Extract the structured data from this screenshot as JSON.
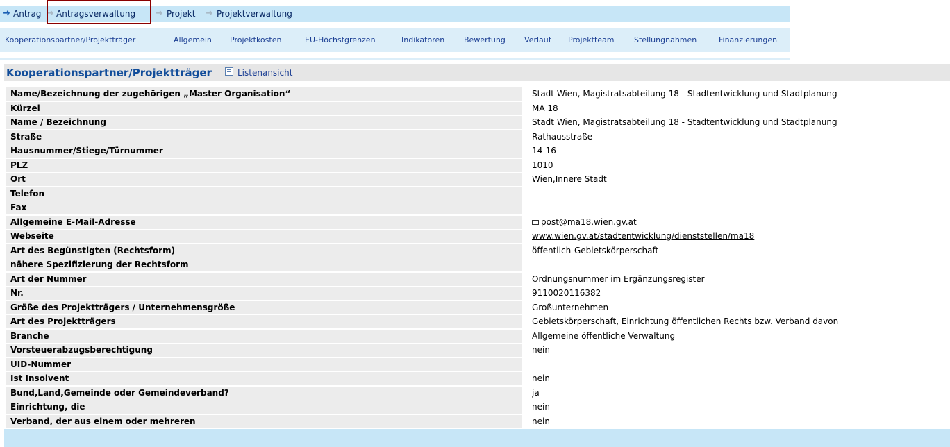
{
  "breadcrumb": {
    "items": [
      "Antrag",
      "Antragsverwaltung",
      "Projekt",
      "Projektverwaltung"
    ]
  },
  "tabs": [
    "Kooperationspartner/Projektträger",
    "Allgemein",
    "Projektkosten",
    "EU-Höchstgrenzen",
    "Indikatoren",
    "Bewertung",
    "Verlauf",
    "Projektteam",
    "Stellungnahmen",
    "Finanzierungen"
  ],
  "section": {
    "title": "Kooperationspartner/Projektträger",
    "list_view_label": "Listenansicht",
    "list_icon": "list-view-icon"
  },
  "rows": [
    {
      "label": "Name/Bezeichnung der zugehörigen „Master Organisation“",
      "value": "Stadt Wien, Magistratsabteilung 18 - Stadtentwicklung und Stadtplanung"
    },
    {
      "label": "Kürzel",
      "value": "MA 18"
    },
    {
      "label": "Name / Bezeichnung",
      "value": "Stadt Wien, Magistratsabteilung 18 - Stadtentwicklung und Stadtplanung"
    },
    {
      "label": "Straße",
      "value": "Rathausstraße"
    },
    {
      "label": "Hausnummer/Stiege/Türnummer",
      "value": "14-16"
    },
    {
      "label": "PLZ",
      "value": "1010"
    },
    {
      "label": "Ort",
      "value": "Wien,Innere Stadt"
    },
    {
      "label": "Telefon",
      "value": ""
    },
    {
      "label": "Fax",
      "value": ""
    },
    {
      "label": "Allgemeine E-Mail-Adresse",
      "value": "post@ma18.wien.gv.at",
      "icon": "mail-icon"
    },
    {
      "label": "Webseite",
      "value": "www.wien.gv.at/stadtentwicklung/dienststellen/ma18"
    },
    {
      "label": "Art des Begünstigten (Rechtsform)",
      "value": "öffentlich-Gebietskörperschaft"
    },
    {
      "label": "nähere Spezifizierung der Rechtsform",
      "value": ""
    },
    {
      "label": "Art der Nummer",
      "value": "Ordnungsnummer im Ergänzungsregister"
    },
    {
      "label": "Nr.",
      "value": "9110020116382"
    },
    {
      "label": "Größe des Projektträgers / Unternehmensgröße",
      "value": "Großunternehmen"
    },
    {
      "label": "Art des Projektträgers",
      "value": "Gebietskörperschaft, Einrichtung öffentlichen Rechts bzw. Verband davon"
    },
    {
      "label": "Branche",
      "value": "Allgemeine öffentliche Verwaltung"
    },
    {
      "label": "Vorsteuerabzugsberechtigung",
      "value": "nein"
    },
    {
      "label": "UID-Nummer",
      "value": ""
    },
    {
      "label": "Ist Insolvent",
      "value": "nein"
    },
    {
      "label": "Bund,Land,Gemeinde oder Gemeindeverband?",
      "value": "ja"
    },
    {
      "label": "Einrichtung, die",
      "value": "nein"
    },
    {
      "label": "Verband, der aus einem oder mehreren",
      "value": "nein"
    }
  ],
  "colors": {
    "breadcrumb_bg": "#c7e6f7",
    "tabbar_bg": "#dceef9",
    "tab_text": "#1c3f94",
    "section_title": "#124d9a",
    "label_bg": "#ececec",
    "active_border": "#8b0000"
  }
}
